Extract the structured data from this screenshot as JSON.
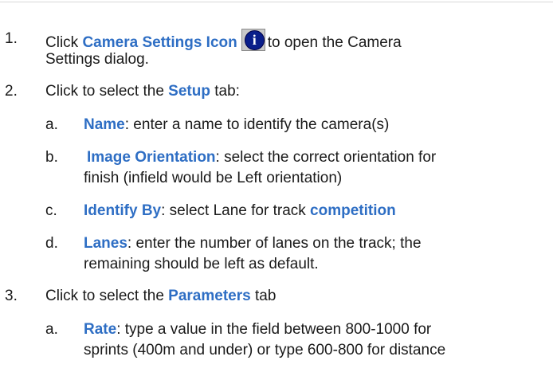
{
  "steps": [
    {
      "number": "1.",
      "line1": {
        "pre": "Click ",
        "hl": "Camera Settings Icon",
        "post": "to open the Camera"
      },
      "line2": "Settings dialog.",
      "icon": {
        "name": "info-icon",
        "glyph": "i",
        "disc_color": "#0a1e8a"
      }
    },
    {
      "number": "2.",
      "line1": {
        "pre": "Click to select the ",
        "hl": "Setup",
        "post": " tab:"
      },
      "substeps": [
        {
          "letter": "a.",
          "hl": "Name",
          "text": ": enter a name to identify the camera(s)"
        },
        {
          "letter": "b.",
          "hl": "Image Orientation",
          "text": ": select the correct orientation for",
          "line2": "finish (infield would be Left orientation)"
        },
        {
          "letter": "c.",
          "hl": "Identify By",
          "text": ": select Lane for track ",
          "hl2": "competition"
        },
        {
          "letter": "d.",
          "hl": "Lanes",
          "text": ": enter the number of lanes on the track; the",
          "line2": "remaining should be left as default."
        }
      ]
    },
    {
      "number": "3.",
      "line1": {
        "pre": "Click to select the ",
        "hl": "Parameters",
        "post": " tab"
      },
      "substeps": [
        {
          "letter": "a.",
          "hl": "Rate",
          "text": ": type a value in the field between 800-1000 for",
          "line2": "sprints (400m and under) or type 600-800 for distance"
        }
      ]
    }
  ],
  "colors": {
    "highlight": "#2e6ec4",
    "text": "#1a1a1a",
    "rule": "#d9d9d9"
  }
}
